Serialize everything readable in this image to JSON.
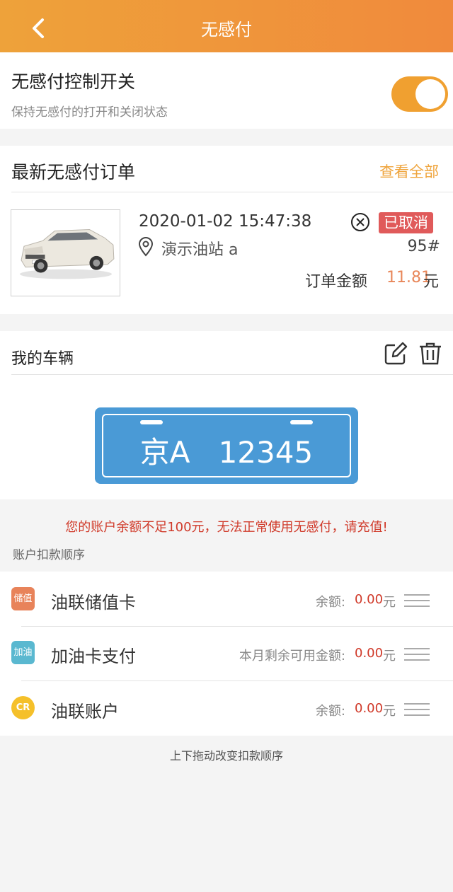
{
  "header": {
    "title": "无感付"
  },
  "switch": {
    "title": "无感付控制开关",
    "description": "保持无感付的打开和关闭状态",
    "enabled": true
  },
  "orders": {
    "title": "最新无感付订单",
    "view_all": "查看全部",
    "latest": {
      "time": "2020-01-02 15:47:38",
      "status": "已取消",
      "station": "演示油站 a",
      "fuel_type": "95#",
      "amount_label": "订单金额",
      "amount": "11.81",
      "amount_unit": "元"
    }
  },
  "vehicle": {
    "title": "我的车辆",
    "plate": "京A   12345"
  },
  "account": {
    "warning": "您的账户余额不足100元，无法正常使用无感付，请充值!",
    "order_label": "账户扣款顺序",
    "methods": [
      {
        "icon_text": "储值",
        "icon_color": "#e8835a",
        "name": "油联储值卡",
        "balance_label": "余额:",
        "balance": "0.00",
        "unit": "元"
      },
      {
        "icon_text": "加油",
        "icon_color": "#5ab8d0",
        "name": "加油卡支付",
        "balance_label": "本月剩余可用金额:",
        "balance": "0.00",
        "unit": "元"
      },
      {
        "icon_text": "CR",
        "icon_color": "#f5c02a",
        "name": "油联账户",
        "balance_label": "余额:",
        "balance": "0.00",
        "unit": "元"
      }
    ],
    "footer_note": "上下拖动改变扣款顺序"
  }
}
